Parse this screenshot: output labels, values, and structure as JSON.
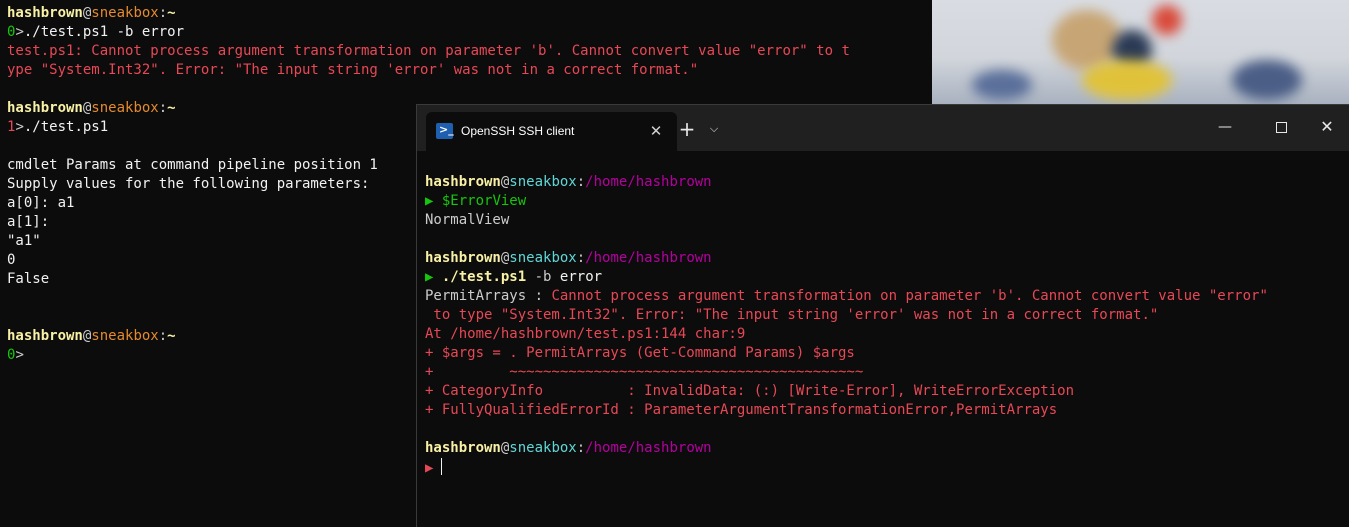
{
  "background_terminal": {
    "block1": {
      "user": "hashbrown",
      "at": "@",
      "host": "sneakbox",
      "colon": ":",
      "path": "~",
      "exit_code": "0",
      "prompt_char": ">",
      "command": "./test.ps1 -b error",
      "error_line1": "test.ps1: Cannot process argument transformation on parameter 'b'. Cannot convert value \"error\" to t",
      "error_line2": "ype \"System.Int32\". Error: \"The input string 'error' was not in a correct format.\""
    },
    "block2": {
      "user": "hashbrown",
      "at": "@",
      "host": "sneakbox",
      "colon": ":",
      "path": "~",
      "exit_code": "1",
      "prompt_char": ">",
      "command": "./test.ps1",
      "output": [
        "cmdlet Params at command pipeline position 1",
        "Supply values for the following parameters:",
        "a[0]: a1",
        "a[1]:",
        "\"a1\"",
        "0",
        "False"
      ]
    },
    "block3": {
      "user": "hashbrown",
      "at": "@",
      "host": "sneakbox",
      "colon": ":",
      "path": "~",
      "exit_code": "0",
      "prompt_char": ">"
    }
  },
  "window": {
    "tab_title": "OpenSSH SSH client",
    "tab_icon": "powershell-icon",
    "tab_close": "✕",
    "new_tab": "+",
    "dropdown": "⌵",
    "minimize": "—",
    "close": "✕"
  },
  "foreground_terminal": {
    "block1": {
      "user": "hashbrown",
      "at": "@",
      "host": "sneakbox",
      "colon": ":",
      "path": "/home/hashbrown",
      "prompt_arrow": "▶",
      "command": "$ErrorView",
      "output": "NormalView"
    },
    "block2": {
      "user": "hashbrown",
      "at": "@",
      "host": "sneakbox",
      "colon": ":",
      "path": "/home/hashbrown",
      "prompt_arrow": "▶",
      "command": "./test.ps1",
      "param": "-b",
      "arg": "error",
      "error_label": "PermitArrays : ",
      "error_line1": "Cannot process argument transformation on parameter 'b'. Cannot convert value \"error\"",
      "error_line2": " to type \"System.Int32\". Error: \"The input string 'error' was not in a correct format.\"",
      "trace": [
        "At /home/hashbrown/test.ps1:144 char:9",
        "+ $args = . PermitArrays (Get-Command Params) $args",
        "+         ~~~~~~~~~~~~~~~~~~~~~~~~~~~~~~~~~~~~~~~~~~",
        "+ CategoryInfo          : InvalidData: (:) [Write-Error], WriteErrorException",
        "+ FullyQualifiedErrorId : ParameterArgumentTransformationError,PermitArrays"
      ]
    },
    "block3": {
      "user": "hashbrown",
      "at": "@",
      "host": "sneakbox",
      "colon": ":",
      "path": "/home/hashbrown",
      "prompt_arrow": "▶"
    }
  }
}
